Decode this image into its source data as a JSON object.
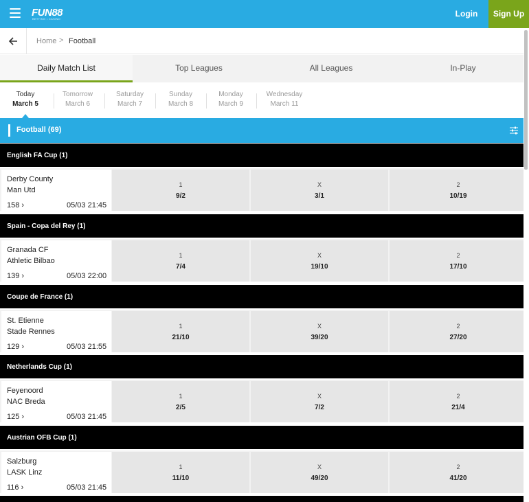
{
  "header": {
    "logo": "FUN88",
    "logo_tagline": "BETTING • CASINO",
    "login_label": "Login",
    "signup_label": "Sign Up",
    "colors": {
      "brand_blue": "#29abe2",
      "signup_green": "#7aa51b"
    }
  },
  "breadcrumb": {
    "home": "Home",
    "separator": ">",
    "current": "Football"
  },
  "tabs": [
    {
      "label": "Daily Match List",
      "active": true
    },
    {
      "label": "Top Leagues",
      "active": false
    },
    {
      "label": "All Leagues",
      "active": false
    },
    {
      "label": "In-Play",
      "active": false
    }
  ],
  "dates": [
    {
      "day": "Today",
      "date": "March 5",
      "active": true
    },
    {
      "day": "Tomorrow",
      "date": "March 6",
      "active": false
    },
    {
      "day": "Saturday",
      "date": "March 7",
      "active": false
    },
    {
      "day": "Sunday",
      "date": "March 8",
      "active": false
    },
    {
      "day": "Monday",
      "date": "March 9",
      "active": false
    },
    {
      "day": "Wednesday",
      "date": "March 11",
      "active": false
    }
  ],
  "sport": {
    "title": "Football  (69)"
  },
  "leagues": [
    {
      "name": "English FA Cup (1)",
      "match": {
        "home": "Derby County",
        "away": "Man Utd",
        "markets": "158",
        "kickoff": "05/03 21:45",
        "odds": [
          {
            "label": "1",
            "value": "9/2"
          },
          {
            "label": "X",
            "value": "3/1"
          },
          {
            "label": "2",
            "value": "10/19"
          }
        ]
      }
    },
    {
      "name": "Spain - Copa del Rey (1)",
      "match": {
        "home": "Granada CF",
        "away": "Athletic Bilbao",
        "markets": "139",
        "kickoff": "05/03 22:00",
        "odds": [
          {
            "label": "1",
            "value": "7/4"
          },
          {
            "label": "X",
            "value": "19/10"
          },
          {
            "label": "2",
            "value": "17/10"
          }
        ]
      }
    },
    {
      "name": "Coupe de France (1)",
      "match": {
        "home": "St. Etienne",
        "away": "Stade Rennes",
        "markets": "129",
        "kickoff": "05/03 21:55",
        "odds": [
          {
            "label": "1",
            "value": "21/10"
          },
          {
            "label": "X",
            "value": "39/20"
          },
          {
            "label": "2",
            "value": "27/20"
          }
        ]
      }
    },
    {
      "name": "Netherlands Cup (1)",
      "match": {
        "home": "Feyenoord",
        "away": "NAC Breda",
        "markets": "125",
        "kickoff": "05/03 21:45",
        "odds": [
          {
            "label": "1",
            "value": "2/5"
          },
          {
            "label": "X",
            "value": "7/2"
          },
          {
            "label": "2",
            "value": "21/4"
          }
        ]
      }
    },
    {
      "name": "Austrian OFB Cup (1)",
      "match": {
        "home": "Salzburg",
        "away": "LASK Linz",
        "markets": "116",
        "kickoff": "05/03 21:45",
        "odds": [
          {
            "label": "1",
            "value": "11/10"
          },
          {
            "label": "X",
            "value": "49/20"
          },
          {
            "label": "2",
            "value": "41/20"
          }
        ]
      }
    }
  ]
}
